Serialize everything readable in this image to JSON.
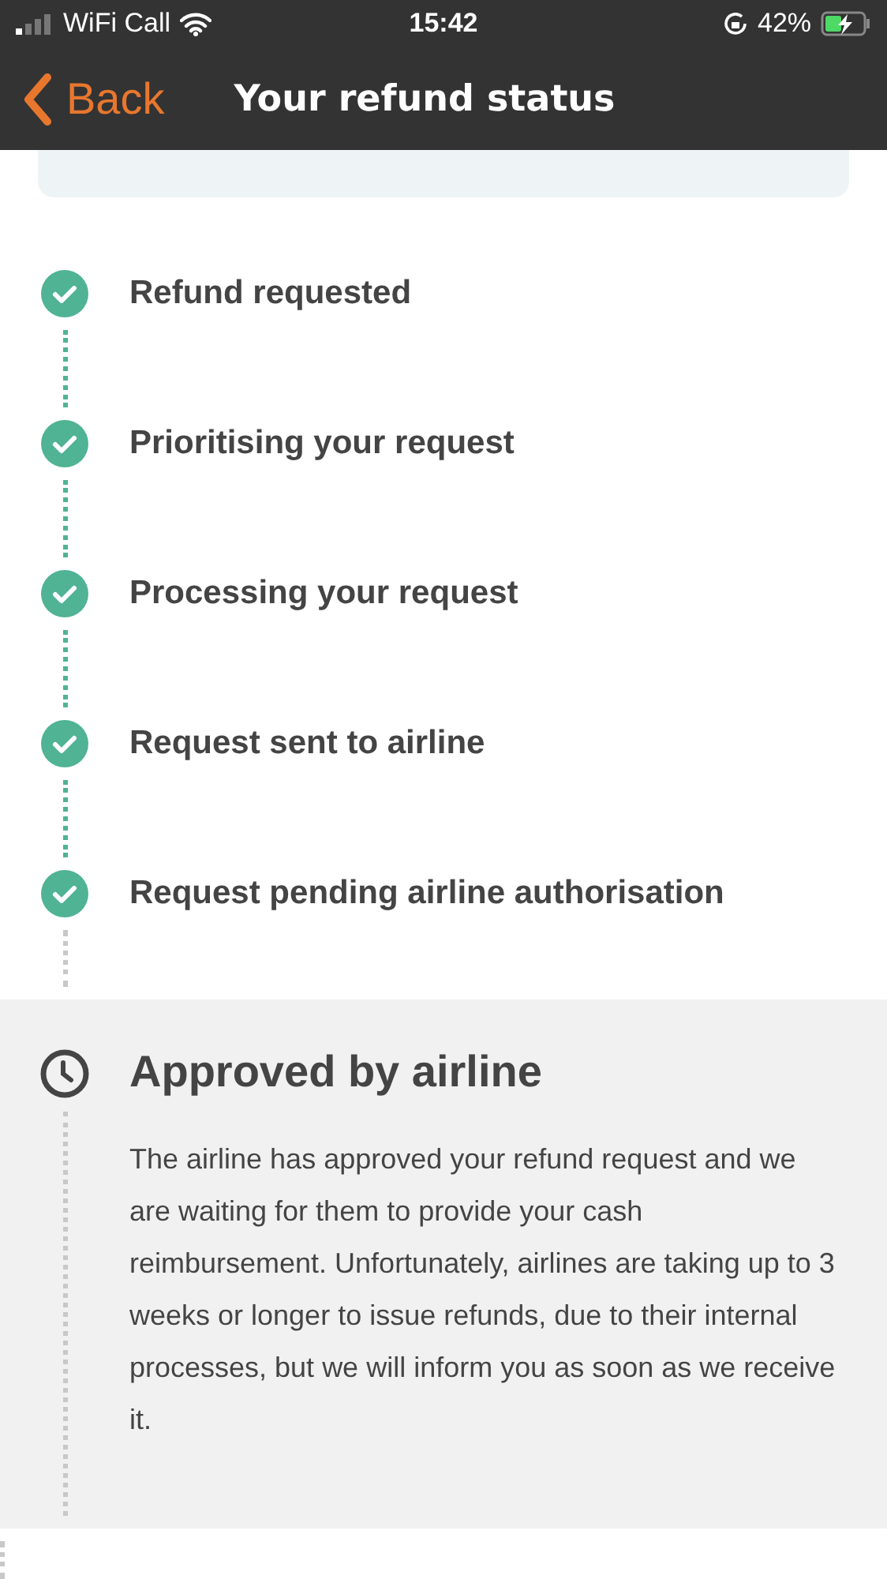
{
  "status_bar": {
    "carrier": "WiFi Call",
    "time": "15:42",
    "battery": "42%",
    "charging": true
  },
  "nav": {
    "back": "Back",
    "title": "Your refund status"
  },
  "steps": [
    {
      "kind": "done",
      "label": "Refund requested"
    },
    {
      "kind": "done",
      "label": "Prioritising your request"
    },
    {
      "kind": "done",
      "label": "Processing your request"
    },
    {
      "kind": "done",
      "label": "Request sent to airline"
    },
    {
      "kind": "done",
      "label": "Request pending airline authorisation"
    },
    {
      "kind": "current",
      "label": "Approved by airline",
      "description": "The airline has approved your refund request and we are waiting for them to provide your cash reimbursement. Unfortunately, airlines are taking up to 3 weeks or longer to issue refunds, due to their internal processes, but we will inform you as soon as we receive it."
    }
  ]
}
